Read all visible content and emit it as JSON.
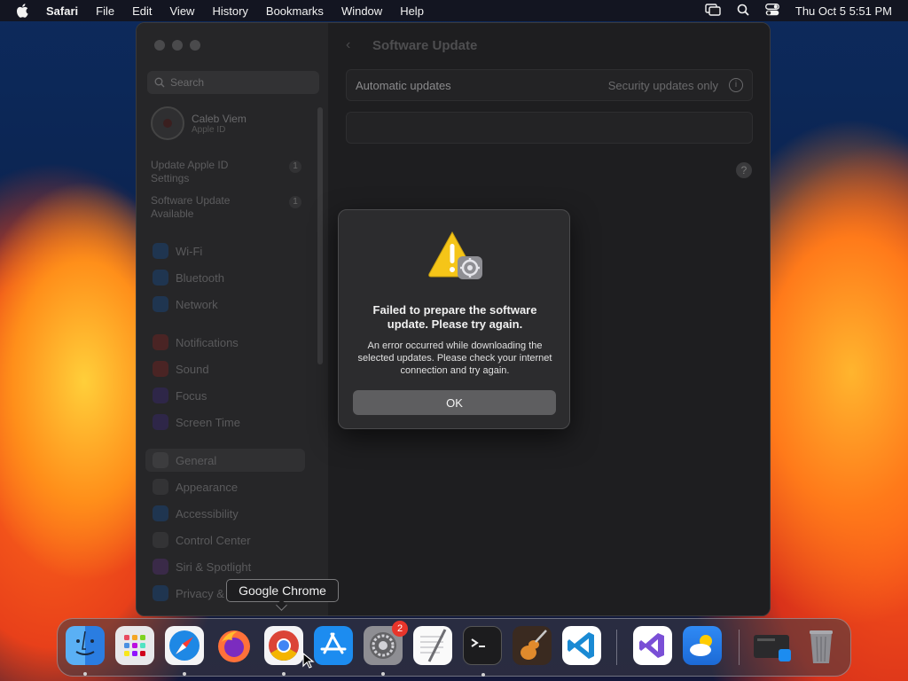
{
  "menubar": {
    "app": "Safari",
    "items": [
      "File",
      "Edit",
      "View",
      "History",
      "Bookmarks",
      "Window",
      "Help"
    ],
    "clock": "Thu Oct 5  5:51 PM"
  },
  "sidebar": {
    "search_placeholder": "Search",
    "profile_name": "Caleb Viem",
    "profile_sub": "Apple ID",
    "alerts": [
      {
        "label": "Update Apple ID Settings",
        "count": "1"
      },
      {
        "label": "Software Update Available",
        "count": "1"
      }
    ],
    "items": [
      "Wi-Fi",
      "Bluetooth",
      "Network",
      "Notifications",
      "Sound",
      "Focus",
      "Screen Time",
      "General",
      "Appearance",
      "Accessibility",
      "Control Center",
      "Siri & Spotlight",
      "Privacy &"
    ]
  },
  "main": {
    "title": "Software Update",
    "auto_label": "Automatic updates",
    "auto_value": "Security updates only",
    "info_glyph": "i",
    "help_glyph": "?"
  },
  "dialog": {
    "heading": "Failed to prepare the software update. Please try again.",
    "body": "An error occurred while downloading the selected updates. Please check your internet connection and try again.",
    "ok_label": "OK"
  },
  "tooltip": "Google Chrome",
  "dock": {
    "apps": [
      "Finder",
      "Launchpad",
      "Safari",
      "Firefox",
      "Google Chrome",
      "App Store",
      "System Settings",
      "TextEdit",
      "Terminal",
      "GarageBand",
      "Visual Studio Code",
      "Visual Studio",
      "Weather",
      "Downloads",
      "Trash"
    ],
    "settings_badge": "2"
  },
  "colors": {
    "accent_red": "#e8352b",
    "dialog_bg": "#2c2c2e",
    "warning_yellow": "#f5c518"
  }
}
